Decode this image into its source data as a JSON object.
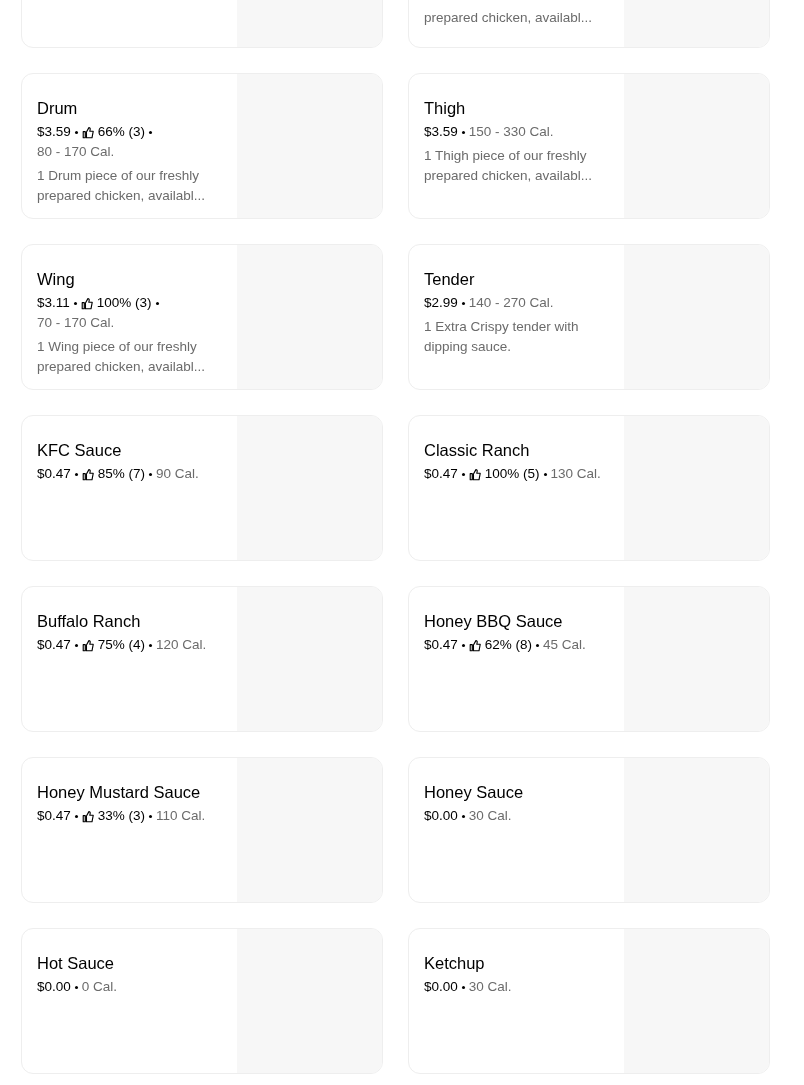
{
  "items": [
    {
      "kind": "image_only"
    },
    {
      "kind": "item",
      "description": "prepared chicken, availabl..."
    },
    {
      "name": "Drum",
      "price": "$3.59",
      "rating": "66% (3)",
      "calories": "80 - 170 Cal.",
      "description": "1 Drum piece of our freshly prepared chicken, availabl..."
    },
    {
      "name": "Thigh",
      "price": "$3.59",
      "calories": "150 - 330 Cal.",
      "description": "1 Thigh piece of our freshly prepared chicken, availabl..."
    },
    {
      "name": "Wing",
      "price": "$3.11",
      "rating": "100% (3)",
      "calories": "70 - 170 Cal.",
      "description": "1 Wing piece of our freshly prepared chicken, availabl..."
    },
    {
      "name": "Tender",
      "price": "$2.99",
      "calories": "140 - 270 Cal.",
      "description": "1 Extra Crispy tender with dipping sauce."
    },
    {
      "name": "KFC Sauce",
      "price": "$0.47",
      "rating": "85% (7)",
      "calories": "90 Cal."
    },
    {
      "name": "Classic Ranch",
      "price": "$0.47",
      "rating": "100% (5)",
      "calories": "130 Cal."
    },
    {
      "name": "Buffalo Ranch",
      "price": "$0.47",
      "rating": "75% (4)",
      "calories": "120 Cal."
    },
    {
      "name": "Honey BBQ Sauce",
      "price": "$0.47",
      "rating": "62% (8)",
      "calories": "45 Cal."
    },
    {
      "name": "Honey Mustard Sauce",
      "price": "$0.47",
      "rating": "33% (3)",
      "calories": "110 Cal."
    },
    {
      "name": "Honey Sauce",
      "price": "$0.00",
      "calories": "30 Cal."
    },
    {
      "name": "Hot Sauce",
      "price": "$0.00",
      "calories": "0 Cal."
    },
    {
      "name": "Ketchup",
      "price": "$0.00",
      "calories": "30 Cal."
    }
  ]
}
